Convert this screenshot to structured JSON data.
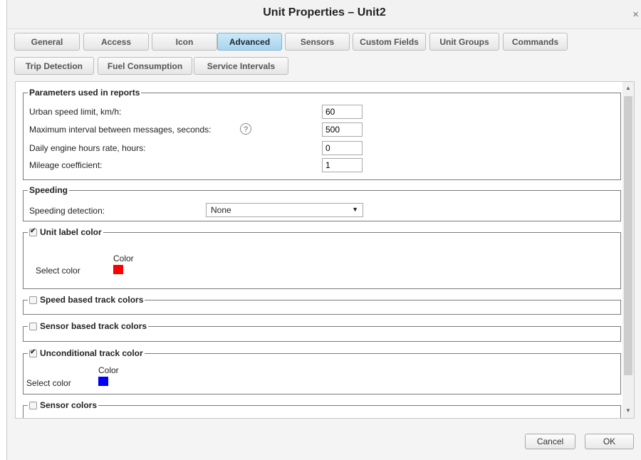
{
  "window": {
    "title": "Unit Properties – Unit2",
    "close_glyph": "×"
  },
  "tabs": [
    {
      "label": "General"
    },
    {
      "label": "Access"
    },
    {
      "label": "Icon"
    },
    {
      "label": "Advanced",
      "active": true
    },
    {
      "label": "Sensors"
    },
    {
      "label": "Custom Fields"
    },
    {
      "label": "Unit Groups"
    },
    {
      "label": "Commands"
    },
    {
      "label": "Trip Detection"
    },
    {
      "label": "Fuel Consumption"
    },
    {
      "label": "Service Intervals"
    }
  ],
  "reports": {
    "title": "Parameters used in reports",
    "urban_speed": {
      "label": "Urban speed limit, km/h:",
      "value": "60"
    },
    "max_interval": {
      "label": "Maximum interval between messages, seconds:",
      "value": "500",
      "help": "?"
    },
    "engine_hours": {
      "label": "Daily engine hours rate, hours:",
      "value": "0"
    },
    "mileage": {
      "label": "Mileage coefficient:",
      "value": "1"
    }
  },
  "speeding": {
    "title": "Speeding",
    "label": "Speeding detection:",
    "value": "None"
  },
  "unit_label_color": {
    "title": "Unit label color",
    "checked": true,
    "color_header": "Color",
    "select_label": "Select color",
    "color": "#ff0000"
  },
  "speed_track": {
    "title": "Speed based track colors",
    "checked": false
  },
  "sensor_track": {
    "title": "Sensor based track colors",
    "checked": false
  },
  "unconditional_track": {
    "title": "Unconditional track color",
    "checked": true,
    "color_header": "Color",
    "select_label": "Select color",
    "color": "#0000ff"
  },
  "sensor_colors": {
    "title": "Sensor colors",
    "checked": false
  },
  "buttons": {
    "cancel": "Cancel",
    "ok": "OK"
  },
  "colors": {
    "active_tab": "#a8d4ee",
    "border": "#7a7a7a"
  }
}
